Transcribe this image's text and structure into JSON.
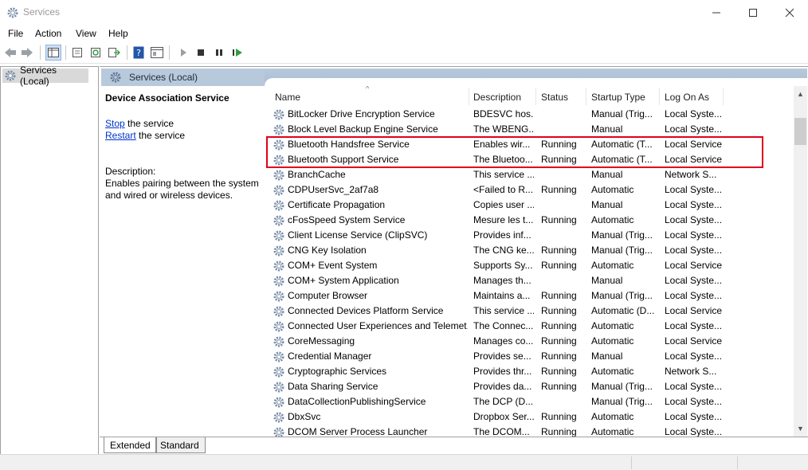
{
  "window": {
    "title": "Services"
  },
  "menu": [
    "File",
    "Action",
    "View",
    "Help"
  ],
  "tree": {
    "item": "Services (Local)"
  },
  "header": {
    "label": "Services (Local)"
  },
  "detail": {
    "title": "Device Association Service",
    "stop_link": "Stop",
    "stop_rest": " the service",
    "restart_link": "Restart",
    "restart_rest": " the service",
    "description_label": "Description:",
    "description_line1": "Enables pairing between the system",
    "description_line2": "and wired or wireless devices."
  },
  "columns": [
    "Name",
    "Description",
    "Status",
    "Startup Type",
    "Log On As"
  ],
  "rows": [
    {
      "name": "BitLocker Drive Encryption Service",
      "description": "BDESVC hos...",
      "status": "",
      "startup": "Manual (Trig...",
      "logon": "Local Syste..."
    },
    {
      "name": "Block Level Backup Engine Service",
      "description": "The WBENG...",
      "status": "",
      "startup": "Manual",
      "logon": "Local Syste..."
    },
    {
      "name": "Bluetooth Handsfree Service",
      "description": "Enables wir...",
      "status": "Running",
      "startup": "Automatic (T...",
      "logon": "Local Service"
    },
    {
      "name": "Bluetooth Support Service",
      "description": "The Bluetoo...",
      "status": "Running",
      "startup": "Automatic (T...",
      "logon": "Local Service"
    },
    {
      "name": "BranchCache",
      "description": "This service ...",
      "status": "",
      "startup": "Manual",
      "logon": "Network S..."
    },
    {
      "name": "CDPUserSvc_2af7a8",
      "description": "<Failed to R...",
      "status": "Running",
      "startup": "Automatic",
      "logon": "Local Syste..."
    },
    {
      "name": "Certificate Propagation",
      "description": "Copies user ...",
      "status": "",
      "startup": "Manual",
      "logon": "Local Syste..."
    },
    {
      "name": "cFosSpeed System Service",
      "description": "Mesure les t...",
      "status": "Running",
      "startup": "Automatic",
      "logon": "Local Syste..."
    },
    {
      "name": "Client License Service (ClipSVC)",
      "description": "Provides inf...",
      "status": "",
      "startup": "Manual (Trig...",
      "logon": "Local Syste..."
    },
    {
      "name": "CNG Key Isolation",
      "description": "The CNG ke...",
      "status": "Running",
      "startup": "Manual (Trig...",
      "logon": "Local Syste..."
    },
    {
      "name": "COM+ Event System",
      "description": "Supports Sy...",
      "status": "Running",
      "startup": "Automatic",
      "logon": "Local Service"
    },
    {
      "name": "COM+ System Application",
      "description": "Manages th...",
      "status": "",
      "startup": "Manual",
      "logon": "Local Syste..."
    },
    {
      "name": "Computer Browser",
      "description": "Maintains a...",
      "status": "Running",
      "startup": "Manual (Trig...",
      "logon": "Local Syste..."
    },
    {
      "name": "Connected Devices Platform Service",
      "description": "This service ...",
      "status": "Running",
      "startup": "Automatic (D...",
      "logon": "Local Service"
    },
    {
      "name": "Connected User Experiences and Telemet...",
      "description": "The Connec...",
      "status": "Running",
      "startup": "Automatic",
      "logon": "Local Syste..."
    },
    {
      "name": "CoreMessaging",
      "description": "Manages co...",
      "status": "Running",
      "startup": "Automatic",
      "logon": "Local Service"
    },
    {
      "name": "Credential Manager",
      "description": "Provides se...",
      "status": "Running",
      "startup": "Manual",
      "logon": "Local Syste..."
    },
    {
      "name": "Cryptographic Services",
      "description": "Provides thr...",
      "status": "Running",
      "startup": "Automatic",
      "logon": "Network S..."
    },
    {
      "name": "Data Sharing Service",
      "description": "Provides da...",
      "status": "Running",
      "startup": "Manual (Trig...",
      "logon": "Local Syste..."
    },
    {
      "name": "DataCollectionPublishingService",
      "description": "The DCP (D...",
      "status": "",
      "startup": "Manual (Trig...",
      "logon": "Local Syste..."
    },
    {
      "name": "DbxSvc",
      "description": "Dropbox Ser...",
      "status": "Running",
      "startup": "Automatic",
      "logon": "Local Syste..."
    },
    {
      "name": "DCOM Server Process Launcher",
      "description": "The DCOM...",
      "status": "Running",
      "startup": "Automatic",
      "logon": "Local Syste..."
    }
  ],
  "tabs": [
    "Extended",
    "Standard"
  ],
  "colors": {
    "highlight": "#e0001b",
    "header": "#b8c9db",
    "link": "#0033cc"
  }
}
